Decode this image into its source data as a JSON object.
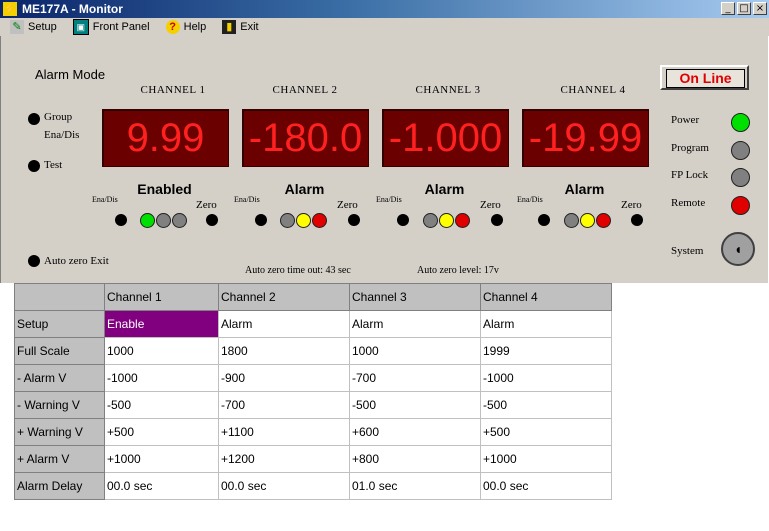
{
  "window": {
    "title": "ME177A - Monitor",
    "controls": [
      "_",
      "□",
      "×"
    ]
  },
  "menu": [
    {
      "label": "Setup",
      "icon": "setup-icon"
    },
    {
      "label": "Front Panel",
      "icon": "front-panel-icon"
    },
    {
      "label": "Help",
      "icon": "help-icon"
    },
    {
      "label": "Exit",
      "icon": "exit-icon"
    }
  ],
  "panel": {
    "alarm_mode": "Alarm Mode",
    "left_controls": {
      "group": "Group",
      "ena_dis": "Ena/Dis",
      "test": "Test",
      "auto_zero_exit": "Auto zero Exit"
    },
    "online_label": "On Line",
    "channels": [
      {
        "name": "CHANNEL 1",
        "display": "9.99",
        "state": "Enabled",
        "leds": [
          "green",
          "gray",
          "gray"
        ]
      },
      {
        "name": "CHANNEL 2",
        "display": "-180.0",
        "state": "Alarm",
        "leds": [
          "gray",
          "yellow",
          "red"
        ]
      },
      {
        "name": "CHANNEL 3",
        "display": "-1.000",
        "state": "Alarm",
        "leds": [
          "gray",
          "yellow",
          "red"
        ]
      },
      {
        "name": "CHANNEL 4",
        "display": "-19.99",
        "state": "Alarm",
        "leds": [
          "gray",
          "yellow",
          "red"
        ]
      }
    ],
    "channel_small": {
      "ena_dis": "Ena/Dis",
      "zero": "Zero"
    },
    "status": [
      {
        "label": "Power",
        "color": "#00e000"
      },
      {
        "label": "Program",
        "color": "#808080"
      },
      {
        "label": "FP Lock",
        "color": "#808080"
      },
      {
        "label": "Remote",
        "color": "#e00000"
      }
    ],
    "system_label": "System",
    "auto_zero_timeout": "Auto zero time out: 43 sec",
    "auto_zero_level": "Auto zero level: 17v"
  },
  "table": {
    "columns": [
      "Channel 1",
      "Channel 2",
      "Channel 3",
      "Channel 4"
    ],
    "rows": [
      {
        "label": "Setup",
        "values": [
          "Enable",
          "Alarm",
          "Alarm",
          "Alarm"
        ]
      },
      {
        "label": "Full Scale",
        "values": [
          "1000",
          "1800",
          "1000",
          "1999"
        ]
      },
      {
        "label": "- Alarm V",
        "values": [
          "-1000",
          "-900",
          "-700",
          "-1000"
        ]
      },
      {
        "label": "- Warning V",
        "values": [
          "-500",
          "-700",
          "-500",
          "-500"
        ]
      },
      {
        "label": "+ Warning V",
        "values": [
          "+500",
          "+1100",
          "+600",
          "+500"
        ]
      },
      {
        "label": "+ Alarm V",
        "values": [
          "+1000",
          "+1200",
          "+800",
          "+1000"
        ]
      },
      {
        "label": "Alarm Delay",
        "values": [
          "00.0 sec",
          "00.0 sec",
          "01.0 sec",
          "00.0 sec"
        ]
      }
    ]
  }
}
